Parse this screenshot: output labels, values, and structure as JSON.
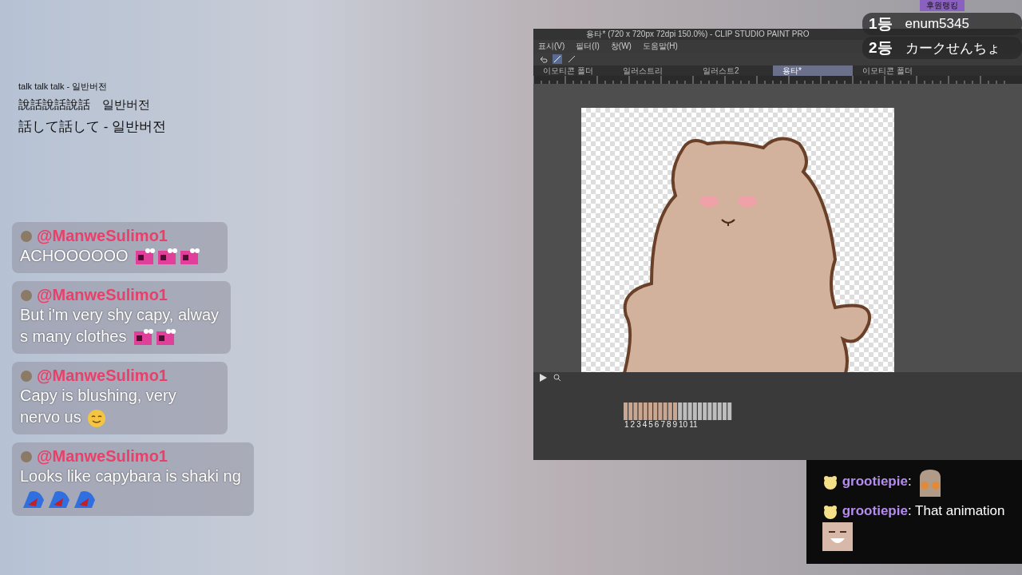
{
  "captions": [
    "talk talk talk - 일반버전",
    "說話說話說話　일반버전",
    "話して話して - 일반버전"
  ],
  "ranking": {
    "title": "후원랭킹",
    "entries": [
      {
        "rank": "1등",
        "name": "enum5345"
      },
      {
        "rank": "2등",
        "name": "カークせんちょ"
      }
    ]
  },
  "paint_window": {
    "title": "용타* (720 x 720px 72dpi 150.0%) - CLIP STUDIO PAINT PRO",
    "menu": [
      "표시(V)",
      "필터(I)",
      "창(W)",
      "도움말(H)"
    ],
    "tabs": [
      {
        "label": "이모티콘 폴더",
        "selected": false
      },
      {
        "label": "일러스트리",
        "selected": false
      },
      {
        "label": "일러스트2",
        "selected": false
      },
      {
        "label": "용타*",
        "selected": true
      },
      {
        "label": "이모티콘 폴더",
        "selected": false
      }
    ],
    "timeline": {
      "frames": [
        "1",
        "2",
        "3",
        "4",
        "5",
        "6",
        "7",
        "8",
        "9",
        "10",
        "11"
      ]
    }
  },
  "chat_left": [
    {
      "user": "@ManweSulimo1",
      "text": "ACHOOOOOO",
      "emotes": [
        {
          "kind": "dino"
        },
        {
          "kind": "dino"
        },
        {
          "kind": "dino"
        }
      ]
    },
    {
      "user": "@ManweSulimo1",
      "text": "But i'm very shy capy, alway s many clothes",
      "emotes": [
        {
          "kind": "dino"
        },
        {
          "kind": "dino"
        }
      ]
    },
    {
      "user": "@ManweSulimo1",
      "text": "Capy is blushing, very nervo us",
      "emotes": [
        {
          "kind": "smile"
        }
      ]
    },
    {
      "user": "@ManweSulimo1",
      "text": "Looks like capybara is shaki ng",
      "emotes": [
        {
          "kind": "blob"
        },
        {
          "kind": "blob"
        },
        {
          "kind": "blob"
        }
      ]
    }
  ],
  "chat_right": [
    {
      "user": "grootiepie",
      "text": ":",
      "emotes": [
        {
          "kind": "bear"
        }
      ]
    },
    {
      "user": "grootiepie",
      "text": ": That animation",
      "emotes": [
        {
          "kind": "face"
        }
      ]
    }
  ]
}
